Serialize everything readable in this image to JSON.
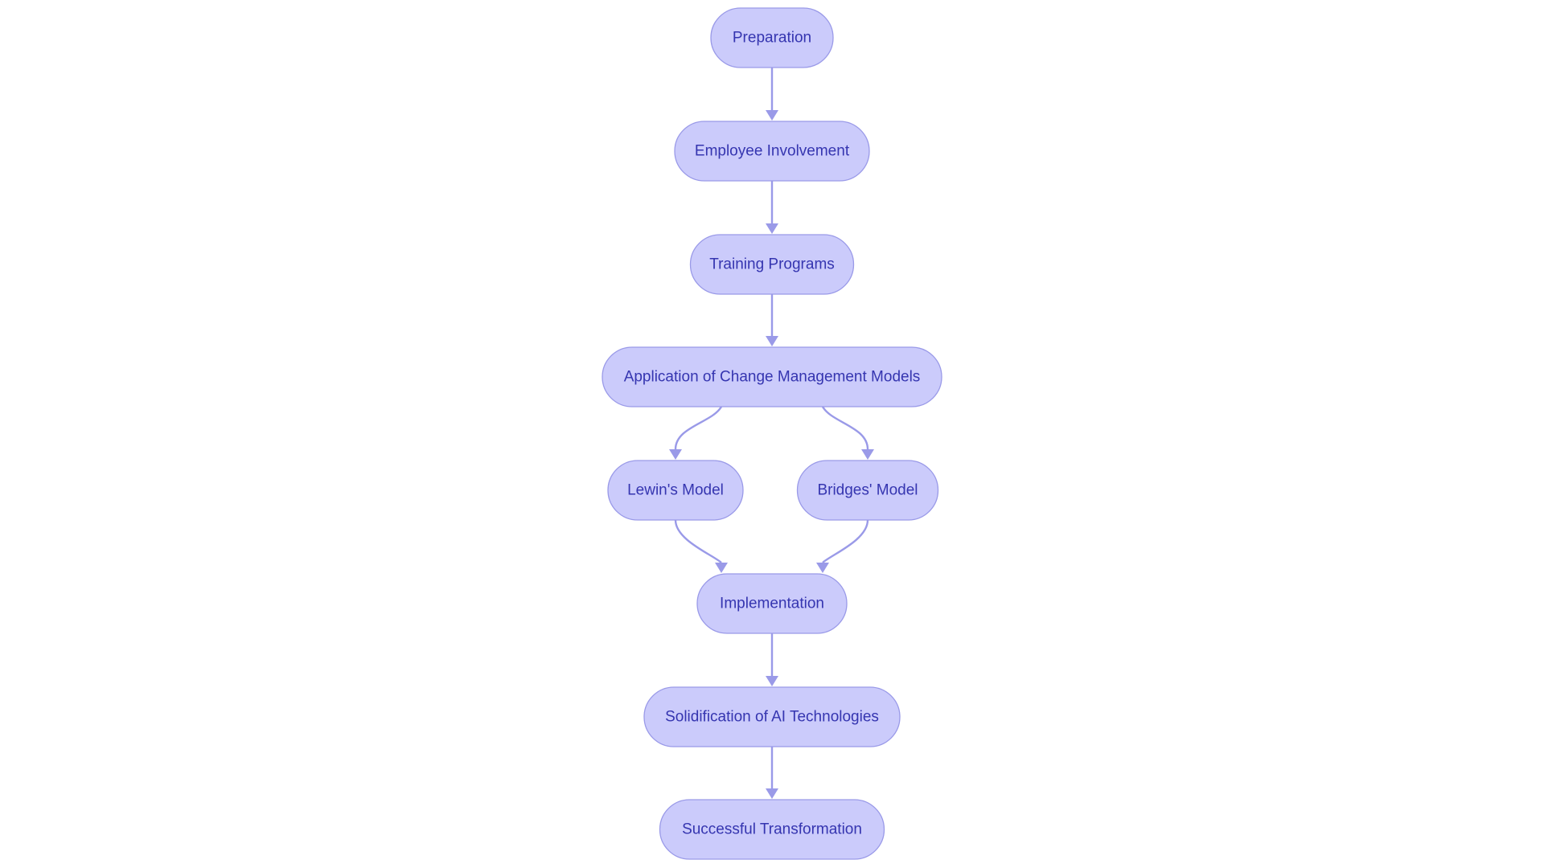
{
  "diagram": {
    "type": "flowchart",
    "direction": "top-down",
    "colors": {
      "node_fill": "#cbcbfb",
      "node_stroke": "#9a9ae8",
      "text": "#3535b0",
      "edge": "#9a9ae8"
    },
    "nodes": [
      {
        "id": "prep",
        "label": "Preparation"
      },
      {
        "id": "emp",
        "label": "Employee Involvement"
      },
      {
        "id": "train",
        "label": "Training Programs"
      },
      {
        "id": "app",
        "label": "Application of Change Management Models"
      },
      {
        "id": "lewin",
        "label": "Lewin's Model"
      },
      {
        "id": "bridges",
        "label": "Bridges' Model"
      },
      {
        "id": "impl",
        "label": "Implementation"
      },
      {
        "id": "solid",
        "label": "Solidification of AI Technologies"
      },
      {
        "id": "success",
        "label": "Successful Transformation"
      }
    ],
    "edges": [
      {
        "from": "prep",
        "to": "emp"
      },
      {
        "from": "emp",
        "to": "train"
      },
      {
        "from": "train",
        "to": "app"
      },
      {
        "from": "app",
        "to": "lewin"
      },
      {
        "from": "app",
        "to": "bridges"
      },
      {
        "from": "lewin",
        "to": "impl"
      },
      {
        "from": "bridges",
        "to": "impl"
      },
      {
        "from": "impl",
        "to": "solid"
      },
      {
        "from": "solid",
        "to": "success"
      }
    ]
  }
}
